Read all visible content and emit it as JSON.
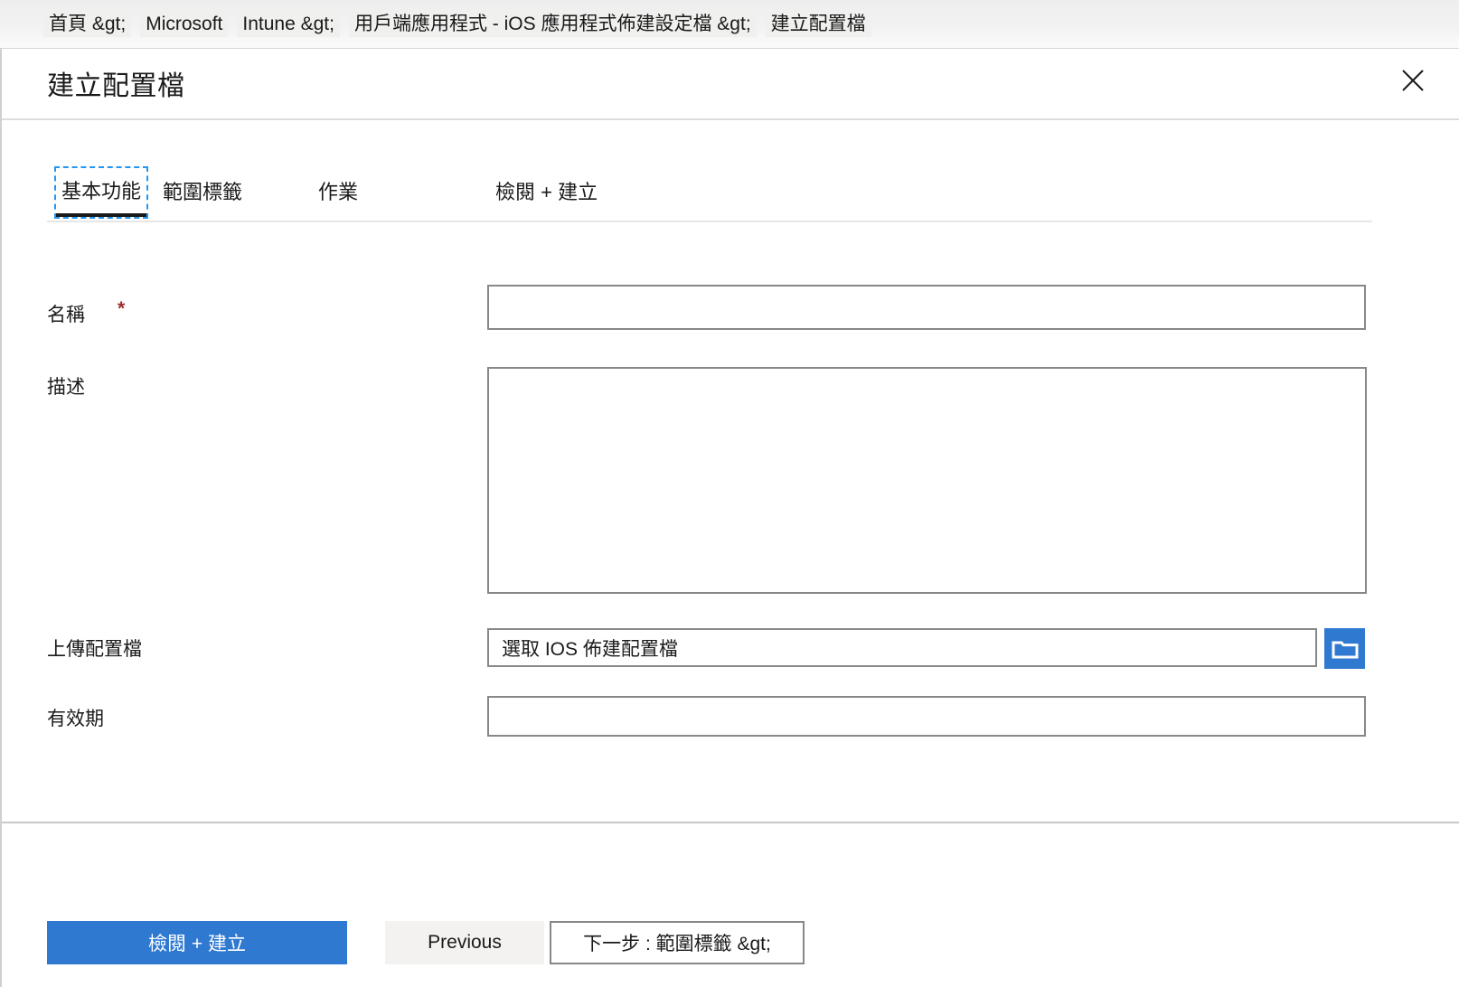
{
  "breadcrumb": {
    "items": [
      {
        "label": "首頁 &gt;"
      },
      {
        "label": "Microsoft"
      },
      {
        "label": "Intune &gt;"
      },
      {
        "label": "用戶端應用程式 - iOS 應用程式佈建設定檔 &gt;"
      },
      {
        "label": "建立配置檔"
      }
    ]
  },
  "header": {
    "title": "建立配置檔",
    "close_icon": "close-icon"
  },
  "tabs": [
    {
      "label": "基本功能",
      "active": true
    },
    {
      "label": "範圍標籤",
      "active": false
    },
    {
      "label": "作業",
      "active": false
    },
    {
      "label": "檢閱 + 建立",
      "active": false
    }
  ],
  "form": {
    "name": {
      "label": "名稱",
      "required_marker": "*",
      "value": "",
      "placeholder": ""
    },
    "description": {
      "label": "描述",
      "value": "",
      "placeholder": ""
    },
    "upload": {
      "label": "上傳配置檔",
      "value": "選取 IOS 佈建配置檔",
      "placeholder": "選取 IOS 佈建配置檔",
      "browse_icon": "folder-icon"
    },
    "expiration": {
      "label": "有效期",
      "value": "",
      "placeholder": ""
    }
  },
  "footer": {
    "review_create_label": "檢閱 + 建立",
    "previous_label": "Previous",
    "next_label": "下一步 : 範圍標籤 &gt;"
  },
  "colors": {
    "primary_blue": "#3079d0",
    "required_red": "#9e2a2b",
    "focus_blue": "#2196f3",
    "border_gray": "#8a8886"
  }
}
